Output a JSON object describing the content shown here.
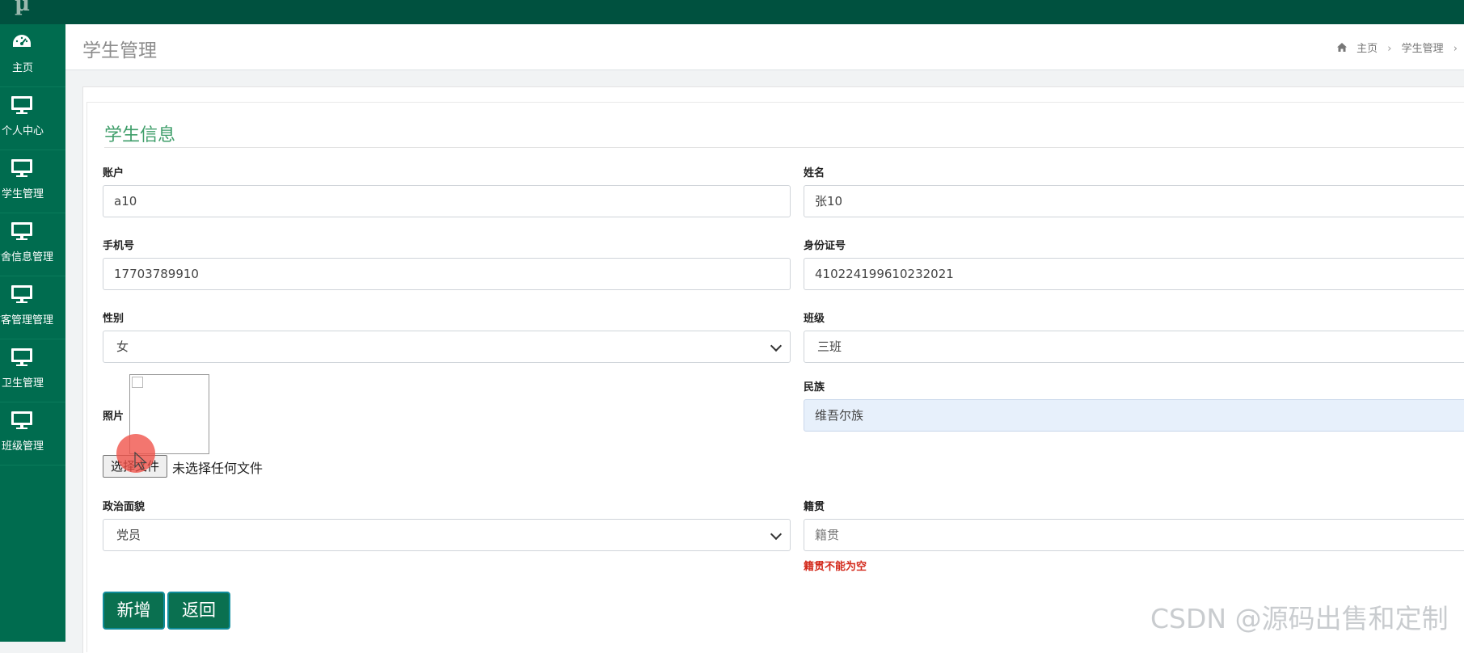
{
  "app": {
    "logo": "µ"
  },
  "sidebar": {
    "items": [
      {
        "label": "主页",
        "icon": "dashboard-icon"
      },
      {
        "label": "个人中心",
        "icon": "monitor-icon"
      },
      {
        "label": "学生管理",
        "icon": "monitor-icon"
      },
      {
        "label": "宿舍信息管理",
        "icon": "monitor-icon"
      },
      {
        "label": "访客管理管理",
        "icon": "monitor-icon"
      },
      {
        "label": "卫生管理",
        "icon": "monitor-icon"
      },
      {
        "label": "班级管理",
        "icon": "monitor-icon"
      }
    ]
  },
  "header": {
    "title": "学生管理",
    "breadcrumb": {
      "home": "主页",
      "current": "学生管理"
    }
  },
  "form": {
    "section_title": "学生信息",
    "account": {
      "label": "账户",
      "value": "a10"
    },
    "name": {
      "label": "姓名",
      "value": "张10"
    },
    "phone": {
      "label": "手机号",
      "value": "17703789910"
    },
    "id_number": {
      "label": "身份证号",
      "value": "410224199610232021"
    },
    "gender": {
      "label": "性别",
      "value": "女"
    },
    "class": {
      "label": "班级",
      "value": "三班"
    },
    "photo": {
      "label": "照片",
      "choose_button": "选择文件",
      "file_status": "未选择任何文件"
    },
    "ethnicity": {
      "label": "民族",
      "value": "维吾尔族"
    },
    "political": {
      "label": "政治面貌",
      "value": "党员"
    },
    "hometown": {
      "label": "籍贯",
      "placeholder": "籍贯",
      "error": "籍贯不能为空"
    },
    "buttons": {
      "add": "新增",
      "back": "返回"
    }
  },
  "watermark": "CSDN @源码出售和定制",
  "colors": {
    "topbar": "#00513f",
    "sidebar": "#006c4f",
    "accent": "#3f9e6a",
    "error": "#d32a1c"
  }
}
